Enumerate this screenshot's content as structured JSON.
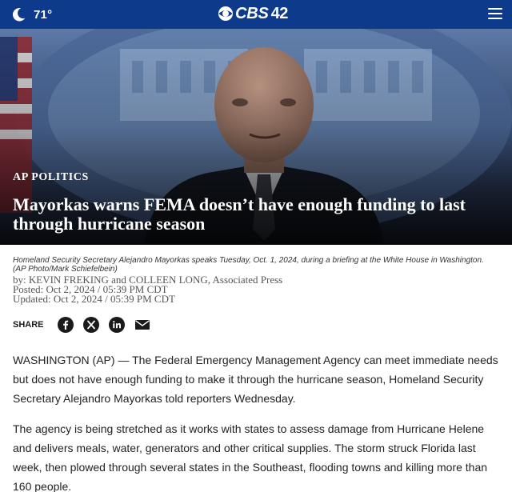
{
  "header": {
    "temperature": "71°",
    "logo_text": "CBS",
    "logo_number": "42",
    "weather_icon": "moon-icon",
    "menu_icon": "hamburger-menu-icon",
    "bg_color": "#0e3a8c"
  },
  "article": {
    "category": "AP POLITICS",
    "headline": "Mayorkas warns FEMA doesn’t have enough funding to last through hurricane season",
    "caption": "Homeland Security Secretary Alejandro Mayorkas speaks Tuesday, Oct. 1, 2024, during a briefing at the White House in Washington. (AP Photo/Mark Schiefelbein)",
    "byline": "by: KEVIN FREKING and COLLEEN LONG, Associated Press",
    "posted": "Posted: Oct 2, 2024 / 05:39 PM CDT",
    "updated": "Updated: Oct 2, 2024 / 05:39 PM CDT",
    "paragraphs": [
      "WASHINGTON (AP) — The Federal Emergency Management Agency can meet immediate needs but does not have enough funding to make it through the hurricane season, Homeland Security Secretary Alejandro Mayorkas told reporters Wednesday.",
      "The agency is being stretched as it works with states to assess damage from Hurricane Helene and delivers meals, water, generators and other critical supplies. The storm struck Florida last week, then plowed through several states in the Southeast, flooding towns and killing more than 160 people."
    ]
  },
  "share": {
    "label": "SHARE",
    "icons": [
      "facebook-icon",
      "x-icon",
      "linkedin-icon",
      "email-icon"
    ]
  }
}
